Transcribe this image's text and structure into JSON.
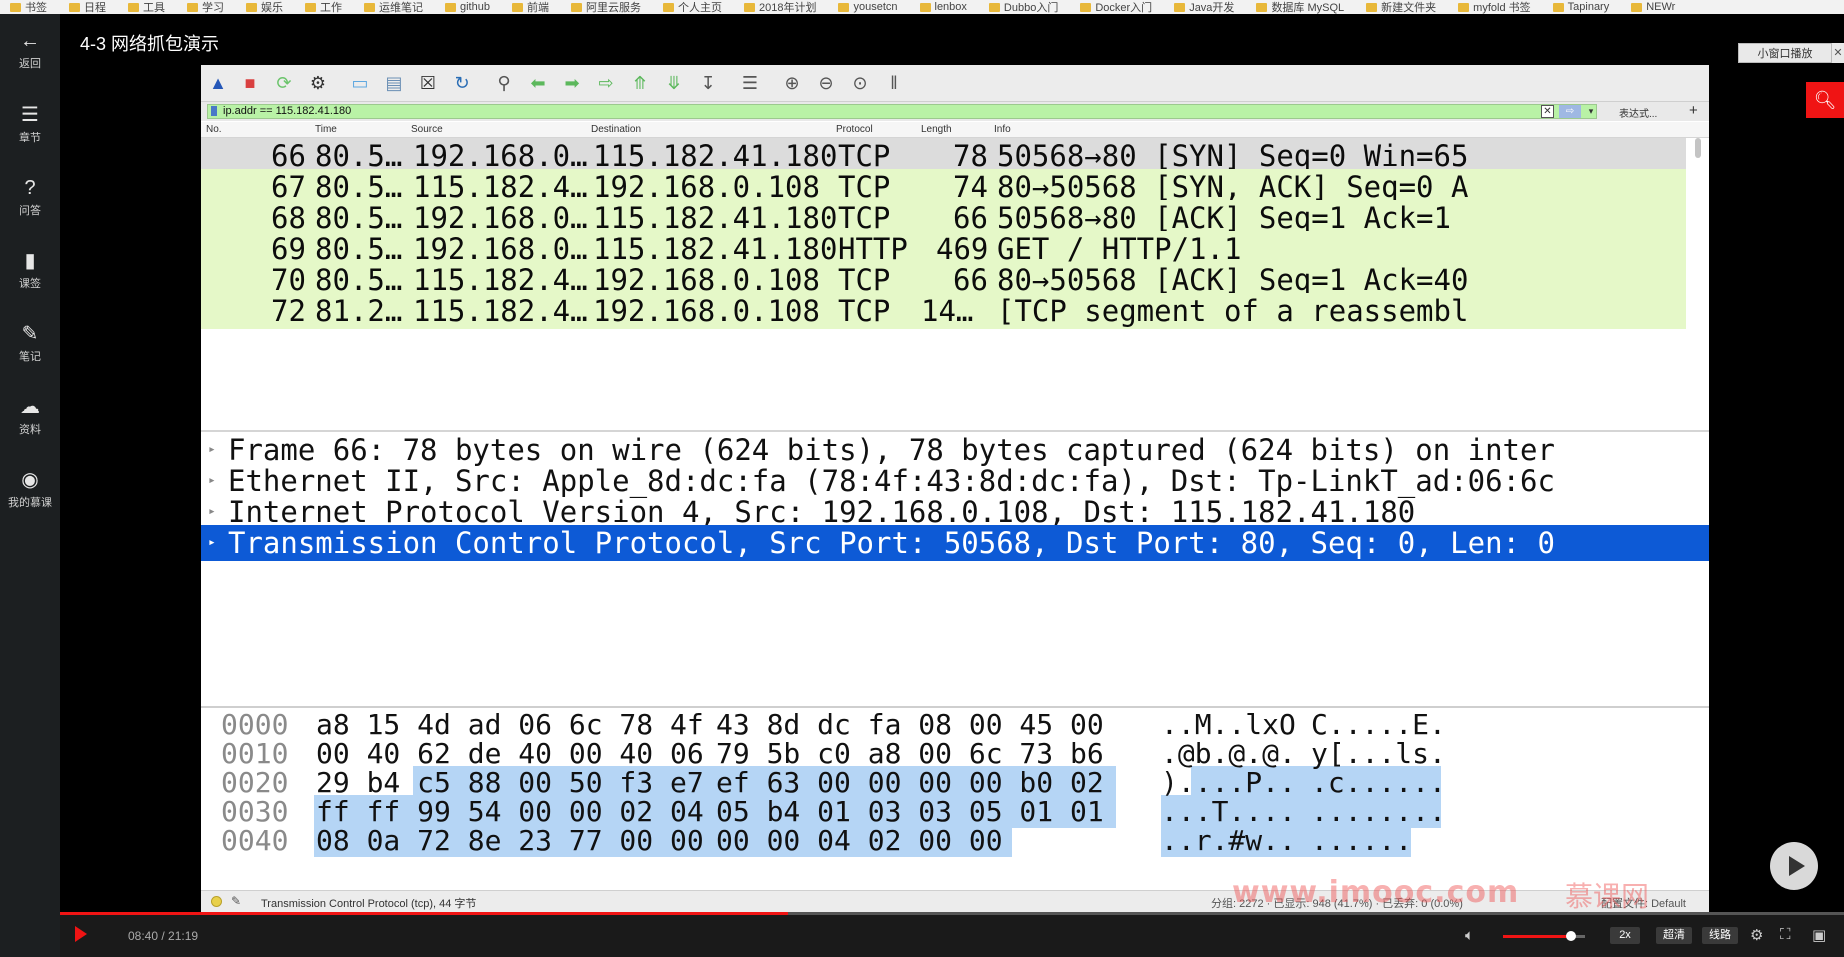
{
  "bookmarks": [
    "书签",
    "日程",
    "工具",
    "学习",
    "娱乐",
    "工作",
    "运维笔记",
    "github",
    "前端",
    "阿里云服务",
    "个人主页",
    "2018年计划",
    "yousetcn",
    "lenbox",
    "Dubbo入门",
    "Docker入门",
    "Java开发",
    "数据库 MySQL",
    "新建文件夹",
    "myfold 书签",
    "Tapinary",
    "NEWr"
  ],
  "sidebar": {
    "items": [
      {
        "icon": "←",
        "label": "返回"
      },
      {
        "icon": "☰",
        "label": "章节"
      },
      {
        "icon": "?",
        "label": "问答"
      },
      {
        "icon": "▮",
        "label": "课签"
      },
      {
        "icon": "✎",
        "label": "笔记"
      },
      {
        "icon": "☁",
        "label": "资料"
      },
      {
        "icon": "◉",
        "label": "我的慕课"
      }
    ]
  },
  "video": {
    "title": "4-3 网络抓包演示",
    "mini_window_label": "小窗口播放",
    "mini_window_close": "✕",
    "search_icon": "search-icon"
  },
  "wireshark": {
    "filter": {
      "value": "ip.addr == 115.182.41.180",
      "expression_label": "表达式...",
      "plus_label": "+",
      "clear_label": "✕",
      "apply_label": "⇨",
      "dropdown_label": "▾"
    },
    "columns": {
      "no": "No.",
      "time": "Time",
      "source": "Source",
      "destination": "Destination",
      "protocol": "Protocol",
      "length": "Length",
      "info": "Info"
    },
    "packets": [
      {
        "no": "66",
        "time": "80.5…",
        "source": "192.168.0…",
        "destination": "115.182.41.180",
        "protocol": "TCP",
        "length": "78",
        "info": "50568→80 [SYN] Seq=0 Win=65"
      },
      {
        "no": "67",
        "time": "80.5…",
        "source": "115.182.4…",
        "destination": "192.168.0.108",
        "protocol": "TCP",
        "length": "74",
        "info": "80→50568 [SYN, ACK] Seq=0 A"
      },
      {
        "no": "68",
        "time": "80.5…",
        "source": "192.168.0…",
        "destination": "115.182.41.180",
        "protocol": "TCP",
        "length": "66",
        "info": "50568→80 [ACK] Seq=1 Ack=1"
      },
      {
        "no": "69",
        "time": "80.5…",
        "source": "192.168.0…",
        "destination": "115.182.41.180",
        "protocol": "HTTP",
        "length": "469",
        "info": "GET / HTTP/1.1"
      },
      {
        "no": "70",
        "time": "80.5…",
        "source": "115.182.4…",
        "destination": "192.168.0.108",
        "protocol": "TCP",
        "length": "66",
        "info": "80→50568 [ACK] Seq=1 Ack=40"
      },
      {
        "no": "72",
        "time": "81.2…",
        "source": "115.182.4…",
        "destination": "192.168.0.108",
        "protocol": "TCP",
        "length": "14…",
        "info": "[TCP segment of a reassembl"
      }
    ],
    "details": [
      "Frame 66: 78 bytes on wire (624 bits), 78 bytes captured (624 bits) on inter",
      "Ethernet II, Src: Apple_8d:dc:fa (78:4f:43:8d:dc:fa), Dst: Tp-LinkT_ad:06:6c",
      "Internet Protocol Version 4, Src: 192.168.0.108, Dst: 115.182.41.180",
      "Transmission Control Protocol, Src Port: 50568, Dst Port: 80, Seq: 0, Len: 0"
    ],
    "hex_rows": [
      {
        "offset": "0000",
        "bytes1": "a8 15 4d ad 06 6c 78 4f",
        "bytes2": "43 8d dc fa 08 00 45 00",
        "ascii1": "..M..lxO",
        "ascii2": "C.....E."
      },
      {
        "offset": "0010",
        "bytes1": "00 40 62 de 40 00 40 06",
        "bytes2": "79 5b c0 a8 00 6c 73 b6",
        "ascii1": ".@b.@.@.",
        "ascii2": "y[...ls."
      },
      {
        "offset": "0020",
        "bytes1": "29 b4 c5 88 00 50 f3 e7",
        "bytes2": "ef 63 00 00 00 00 b0 02",
        "ascii1": ")....P..",
        "ascii2": ".c......"
      },
      {
        "offset": "0030",
        "bytes1": "ff ff 99 54 00 00 02 04",
        "bytes2": "05 b4 01 03 03 05 01 01",
        "ascii1": "...T....",
        "ascii2": "........"
      },
      {
        "offset": "0040",
        "bytes1": "08 0a 72 8e 23 77 00 00",
        "bytes2": "00 00 04 02 00 00",
        "ascii1": "..r.#w..",
        "ascii2": "......"
      }
    ],
    "status": {
      "left": "Transmission Control Protocol (tcp), 44 字节",
      "mid": "分组: 2272 · 已显示: 948 (41.7%) · 已丢弃: 0 (0.0%)",
      "right": "配置文件: Default"
    }
  },
  "watermark": {
    "text": "www.imooc.com",
    "brand": "慕课网"
  },
  "player": {
    "time": "08:40 / 21:19",
    "progress": 0.408,
    "volume": 0.83,
    "speed_label": "2x",
    "quality_label": "超清",
    "line_label": "线路",
    "accent": "#f01414"
  }
}
